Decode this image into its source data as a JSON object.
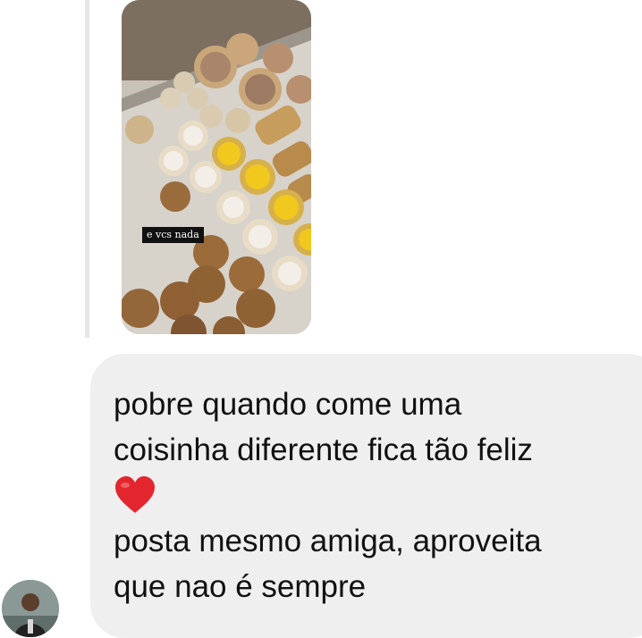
{
  "reply": {
    "story_caption": "e vcs nada"
  },
  "message": {
    "lines": [
      "pobre quando come uma",
      "coisinha diferente fica tão feliz",
      "posta mesmo amiga, aproveita",
      "que nao é sempre"
    ],
    "emoji": "red-heart-icon"
  },
  "colors": {
    "bubble": "#efefef",
    "heart": "#e3262e",
    "reply_bar": "#e6e6e6"
  }
}
